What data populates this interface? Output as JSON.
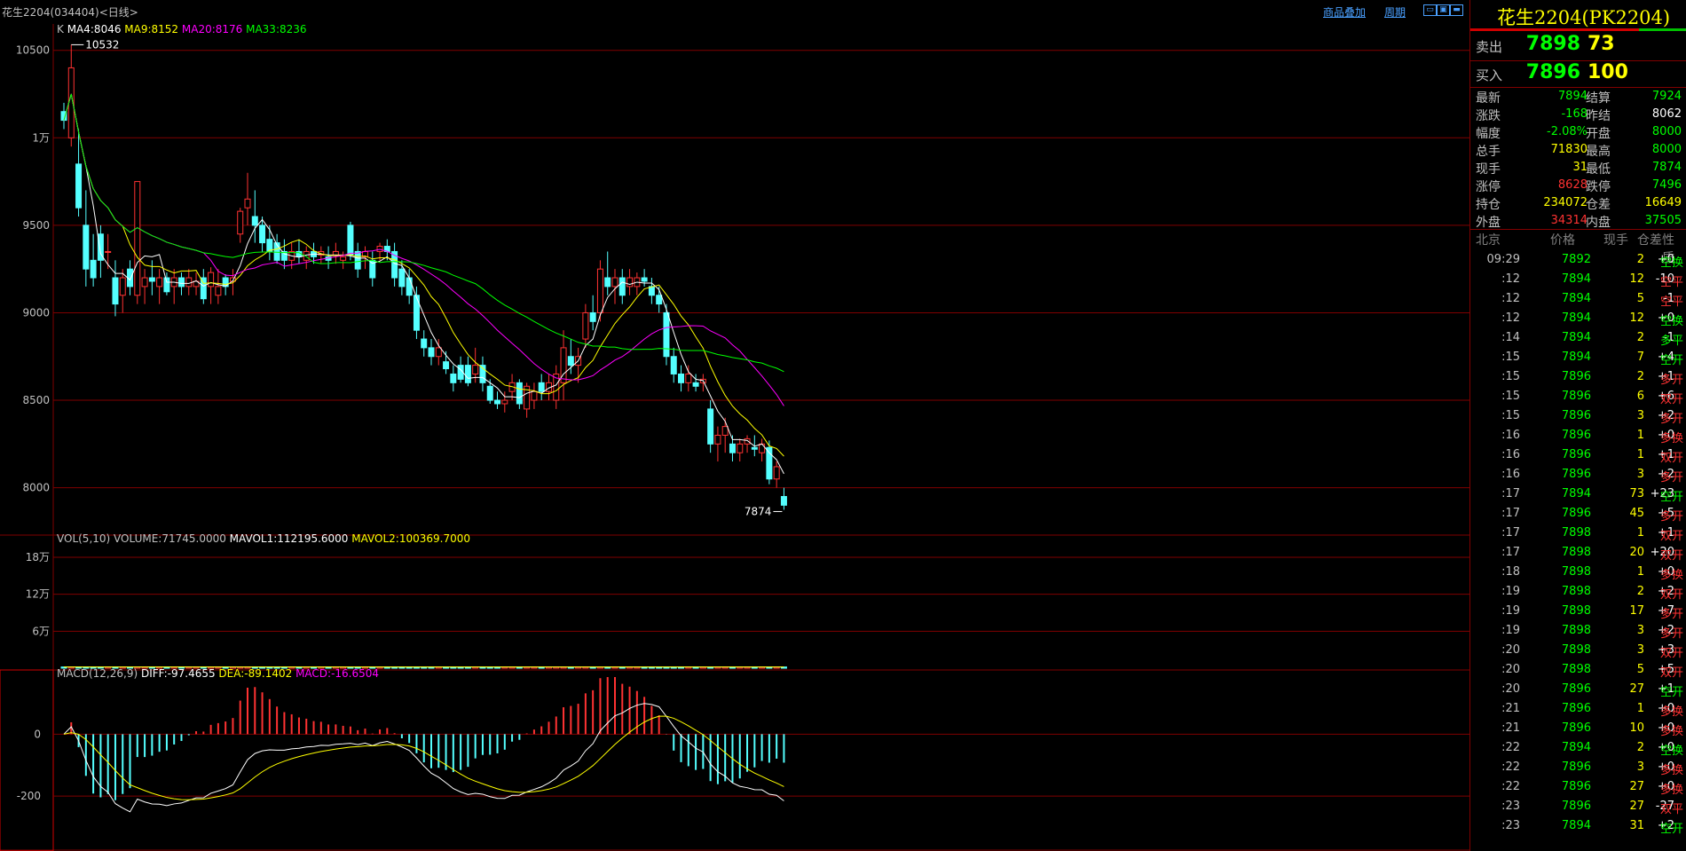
{
  "header": {
    "title": "花生2204(034404)<日线>",
    "link_overlay": "商品叠加",
    "link_period": "周期",
    "window_buttons": [
      "minimize-icon",
      "restore-icon",
      "close-icon"
    ]
  },
  "colors": {
    "up": "#ff3232",
    "down": "#54ffff",
    "ma4": "#ffffff",
    "ma9": "#ffff00",
    "ma20": "#ff00ff",
    "ma33": "#00ff00",
    "grid": "#800000",
    "axis_text": "#c0c0c0"
  },
  "chart_data": [
    {
      "type": "candlestick",
      "legend": {
        "prefix": "K",
        "items": [
          "MA4:8046",
          "MA9:8152",
          "MA20:8176",
          "MA33:8236"
        ]
      },
      "ylim": [
        7780,
        10600
      ],
      "y_ticks": [
        {
          "v": 10500,
          "label": "10500"
        },
        {
          "v": 10000,
          "label": "1万"
        },
        {
          "v": 9500,
          "label": "9500"
        },
        {
          "v": 9000,
          "label": "9000"
        },
        {
          "v": 8500,
          "label": "8500"
        },
        {
          "v": 8000,
          "label": "8000"
        }
      ],
      "annotations": [
        {
          "label": "10532",
          "value": 10532,
          "bar": 1
        },
        {
          "label": "7874",
          "value": 7874,
          "bar": 98
        }
      ],
      "ohlc": [
        [
          10150,
          10200,
          10050,
          10100
        ],
        [
          10000,
          10532,
          9950,
          10400
        ],
        [
          9850,
          10050,
          9550,
          9600
        ],
        [
          9500,
          9700,
          9150,
          9250
        ],
        [
          9300,
          9450,
          9150,
          9200
        ],
        [
          9450,
          9500,
          9200,
          9300
        ],
        [
          9350,
          9450,
          9250,
          9350
        ],
        [
          9200,
          9300,
          8980,
          9050
        ],
        [
          9100,
          9250,
          9000,
          9200
        ],
        [
          9250,
          9300,
          9100,
          9150
        ],
        [
          9100,
          9700,
          9050,
          9750
        ],
        [
          9150,
          9250,
          9050,
          9200
        ],
        [
          9200,
          9300,
          9100,
          9180
        ],
        [
          9150,
          9250,
          9050,
          9200
        ],
        [
          9200,
          9230,
          9100,
          9120
        ],
        [
          9150,
          9250,
          9050,
          9200
        ],
        [
          9200,
          9230,
          9100,
          9150
        ],
        [
          9150,
          9250,
          9100,
          9200
        ],
        [
          9150,
          9230,
          9100,
          9180
        ],
        [
          9200,
          9250,
          9050,
          9080
        ],
        [
          9150,
          9260,
          9050,
          9230
        ],
        [
          9100,
          9250,
          9050,
          9150
        ],
        [
          9200,
          9220,
          9100,
          9150
        ],
        [
          9180,
          9250,
          9100,
          9200
        ],
        [
          9450,
          9600,
          9400,
          9580
        ],
        [
          9600,
          9800,
          9500,
          9650
        ],
        [
          9550,
          9700,
          9400,
          9500
        ],
        [
          9500,
          9550,
          9350,
          9400
        ],
        [
          9420,
          9500,
          9300,
          9350
        ],
        [
          9400,
          9450,
          9280,
          9300
        ],
        [
          9350,
          9420,
          9250,
          9300
        ],
        [
          9300,
          9400,
          9250,
          9350
        ],
        [
          9350,
          9420,
          9280,
          9320
        ],
        [
          9300,
          9380,
          9250,
          9350
        ],
        [
          9350,
          9400,
          9280,
          9320
        ],
        [
          9330,
          9380,
          9280,
          9350
        ],
        [
          9320,
          9380,
          9250,
          9300
        ],
        [
          9330,
          9400,
          9280,
          9350
        ],
        [
          9300,
          9350,
          9250,
          9320
        ],
        [
          9500,
          9520,
          9300,
          9330
        ],
        [
          9350,
          9400,
          9200,
          9250
        ],
        [
          9320,
          9380,
          9250,
          9350
        ],
        [
          9300,
          9350,
          9150,
          9200
        ],
        [
          9350,
          9400,
          9300,
          9380
        ],
        [
          9380,
          9420,
          9300,
          9350
        ],
        [
          9350,
          9400,
          9150,
          9200
        ],
        [
          9250,
          9300,
          9100,
          9150
        ],
        [
          9200,
          9250,
          9050,
          9100
        ],
        [
          9100,
          9150,
          8850,
          8900
        ],
        [
          8850,
          8900,
          8750,
          8800
        ],
        [
          8800,
          8850,
          8700,
          8750
        ],
        [
          8750,
          8850,
          8700,
          8800
        ],
        [
          8720,
          8780,
          8650,
          8680
        ],
        [
          8650,
          8700,
          8550,
          8600
        ],
        [
          8700,
          8750,
          8600,
          8620
        ],
        [
          8700,
          8750,
          8580,
          8600
        ],
        [
          8650,
          8800,
          8600,
          8700
        ],
        [
          8700,
          8750,
          8550,
          8600
        ],
        [
          8580,
          8620,
          8480,
          8500
        ],
        [
          8500,
          8550,
          8450,
          8480
        ],
        [
          8480,
          8550,
          8430,
          8500
        ],
        [
          8550,
          8650,
          8500,
          8600
        ],
        [
          8600,
          8620,
          8450,
          8480
        ],
        [
          8450,
          8600,
          8400,
          8580
        ],
        [
          8500,
          8600,
          8450,
          8550
        ],
        [
          8600,
          8650,
          8500,
          8550
        ],
        [
          8550,
          8650,
          8500,
          8600
        ],
        [
          8500,
          8700,
          8450,
          8650
        ],
        [
          8600,
          8900,
          8500,
          8800
        ],
        [
          8750,
          8850,
          8650,
          8700
        ],
        [
          8700,
          8800,
          8600,
          8750
        ],
        [
          8850,
          9050,
          8800,
          9000
        ],
        [
          9000,
          9100,
          8900,
          8950
        ],
        [
          9000,
          9300,
          8950,
          9250
        ],
        [
          9200,
          9350,
          9100,
          9150
        ],
        [
          9150,
          9250,
          9050,
          9200
        ],
        [
          9200,
          9250,
          9050,
          9100
        ],
        [
          9150,
          9250,
          9100,
          9200
        ],
        [
          9150,
          9230,
          9100,
          9200
        ],
        [
          9200,
          9250,
          9150,
          9180
        ],
        [
          9150,
          9200,
          9050,
          9100
        ],
        [
          9100,
          9150,
          9000,
          9050
        ],
        [
          9000,
          9050,
          8700,
          8750
        ],
        [
          8750,
          8800,
          8600,
          8650
        ],
        [
          8650,
          8700,
          8550,
          8600
        ],
        [
          8600,
          8700,
          8550,
          8650
        ],
        [
          8600,
          8650,
          8550,
          8580
        ],
        [
          8600,
          8650,
          8550,
          8620
        ],
        [
          8450,
          8500,
          8200,
          8250
        ],
        [
          8250,
          8350,
          8150,
          8300
        ],
        [
          8300,
          8400,
          8200,
          8350
        ],
        [
          8250,
          8300,
          8150,
          8200
        ],
        [
          8200,
          8280,
          8150,
          8250
        ],
        [
          8250,
          8300,
          8200,
          8280
        ],
        [
          8230,
          8300,
          8180,
          8220
        ],
        [
          8200,
          8280,
          8150,
          8250
        ],
        [
          8230,
          8270,
          8020,
          8050
        ],
        [
          8050,
          8150,
          8000,
          8120
        ],
        [
          7950,
          8000,
          7874,
          7900
        ]
      ]
    },
    {
      "type": "bar",
      "legend": {
        "prefix": "VOL(5,10)",
        "items": [
          "VOLUME:71745.0000",
          "MAVOL1:112195.6000",
          "MAVOL2:100369.7000"
        ]
      },
      "ylim": [
        0,
        190000
      ],
      "y_ticks": [
        {
          "v": 180000,
          "label": "18万"
        },
        {
          "v": 120000,
          "label": "12万"
        },
        {
          "v": 60000,
          "label": "6万"
        }
      ],
      "values": [
        2000,
        2000,
        2000,
        2000,
        2000,
        2000,
        2000,
        2000,
        2000,
        2000,
        2000,
        2000,
        2000,
        2000,
        2000,
        2000,
        2000,
        2000,
        2000,
        2000,
        2000,
        2000,
        2000,
        2000,
        2000,
        2000,
        2000,
        2000,
        2000,
        2000,
        2000,
        2000,
        2000,
        2000,
        2000,
        2000,
        2000,
        2000,
        2000,
        2000,
        2000,
        2000,
        2000,
        2000,
        2000,
        2000,
        2000,
        2000,
        2000,
        2000,
        2000,
        2000,
        2000,
        2000,
        2000,
        2000,
        2000,
        2000,
        2000,
        2000,
        2000,
        2000,
        2000,
        2000,
        2000,
        2000,
        2000,
        2000,
        2000,
        2000,
        2000,
        2000,
        2000,
        2000,
        2000,
        2000,
        2000,
        2000,
        2000,
        2000,
        2000,
        2000,
        2000,
        2000,
        2000,
        2000,
        2000,
        2000,
        2000,
        2000,
        2000,
        2000,
        2000,
        2000,
        2000,
        2000,
        2000,
        2000,
        2000,
        2000,
        2000,
        2000,
        2000,
        2000,
        2000,
        2000,
        2000,
        2000,
        2000,
        2000,
        2000,
        2000,
        2000,
        2000,
        2000,
        2000,
        2000,
        2000,
        2000,
        2000,
        2000,
        2000,
        2000,
        2000,
        2000
      ]
    },
    {
      "type": "bar",
      "legend": {
        "prefix": "MACD(12,26,9)",
        "items": [
          "DIFF:-97.4655",
          "DEA:-89.1402",
          "MACD:-16.6504"
        ]
      },
      "ylim": [
        -360,
        190
      ],
      "y_ticks": [
        {
          "v": 0,
          "label": "0"
        },
        {
          "v": -200,
          "label": "-200"
        }
      ]
    }
  ],
  "side": {
    "title": "花生2204(PK2204)",
    "sell": {
      "label": "卖出",
      "price": "7898",
      "volume": "73"
    },
    "buy": {
      "label": "买入",
      "price": "7896",
      "volume": "100"
    },
    "quotes": [
      {
        "l1": "最新",
        "v1": "7894",
        "c1": "#00ff00",
        "l2": "结算",
        "v2": "7924",
        "c2": "#00ff00"
      },
      {
        "l1": "涨跌",
        "v1": "-168",
        "c1": "#00ff00",
        "l2": "昨结",
        "v2": "8062",
        "c2": "#ffffff"
      },
      {
        "l1": "幅度",
        "v1": "-2.08%",
        "c1": "#00ff00",
        "l2": "开盘",
        "v2": "8000",
        "c2": "#00ff00"
      },
      {
        "l1": "总手",
        "v1": "71830",
        "c1": "#ffff00",
        "l2": "最高",
        "v2": "8000",
        "c2": "#00ff00"
      },
      {
        "l1": "现手",
        "v1": "31",
        "c1": "#ffff00",
        "l2": "最低",
        "v2": "7874",
        "c2": "#00ff00"
      },
      {
        "l1": "涨停",
        "v1": "8628",
        "c1": "#ff3232",
        "l2": "跌停",
        "v2": "7496",
        "c2": "#00ff00"
      },
      {
        "l1": "持仓",
        "v1": "234072",
        "c1": "#ffff00",
        "l2": "仓差",
        "v2": "16649",
        "c2": "#ffff00"
      },
      {
        "l1": "外盘",
        "v1": "34314",
        "c1": "#ff3232",
        "l2": "内盘",
        "v2": "37505",
        "c2": "#00ff00"
      }
    ],
    "tick_headers": [
      "北京",
      "价格",
      "现手",
      "仓差",
      "性质"
    ],
    "ticks": [
      {
        "time": "09:29",
        "price": "7892",
        "hand": "2",
        "oi": "+0",
        "nature": "空换",
        "pc": "#00ff00",
        "nc": "#00ff00"
      },
      {
        "time": ":12",
        "price": "7894",
        "hand": "12",
        "oi": "-10",
        "nature": "空平",
        "pc": "#00ff00",
        "nc": "#ff3232"
      },
      {
        "time": ":12",
        "price": "7894",
        "hand": "5",
        "oi": "-1",
        "nature": "空平",
        "pc": "#00ff00",
        "nc": "#ff3232"
      },
      {
        "time": ":12",
        "price": "7894",
        "hand": "12",
        "oi": "+0",
        "nature": "空换",
        "pc": "#00ff00",
        "nc": "#00ff00"
      },
      {
        "time": ":14",
        "price": "7894",
        "hand": "2",
        "oi": "-1",
        "nature": "多平",
        "pc": "#00ff00",
        "nc": "#00ff00"
      },
      {
        "time": ":15",
        "price": "7894",
        "hand": "7",
        "oi": "+4",
        "nature": "空开",
        "pc": "#00ff00",
        "nc": "#00ff00"
      },
      {
        "time": ":15",
        "price": "7896",
        "hand": "2",
        "oi": "+1",
        "nature": "多开",
        "pc": "#00ff00",
        "nc": "#ff3232"
      },
      {
        "time": ":15",
        "price": "7896",
        "hand": "6",
        "oi": "+6",
        "nature": "双开",
        "pc": "#00ff00",
        "nc": "#ff3232"
      },
      {
        "time": ":15",
        "price": "7896",
        "hand": "3",
        "oi": "+2",
        "nature": "多开",
        "pc": "#00ff00",
        "nc": "#ff3232"
      },
      {
        "time": ":16",
        "price": "7896",
        "hand": "1",
        "oi": "+0",
        "nature": "多换",
        "pc": "#00ff00",
        "nc": "#ff3232"
      },
      {
        "time": ":16",
        "price": "7896",
        "hand": "1",
        "oi": "+1",
        "nature": "双开",
        "pc": "#00ff00",
        "nc": "#ff3232"
      },
      {
        "time": ":16",
        "price": "7896",
        "hand": "3",
        "oi": "+2",
        "nature": "多开",
        "pc": "#00ff00",
        "nc": "#ff3232"
      },
      {
        "time": ":17",
        "price": "7894",
        "hand": "73",
        "oi": "+23",
        "nature": "空开",
        "pc": "#00ff00",
        "nc": "#00ff00"
      },
      {
        "time": ":17",
        "price": "7896",
        "hand": "45",
        "oi": "+5",
        "nature": "多开",
        "pc": "#00ff00",
        "nc": "#ff3232"
      },
      {
        "time": ":17",
        "price": "7898",
        "hand": "1",
        "oi": "+1",
        "nature": "双开",
        "pc": "#00ff00",
        "nc": "#ff3232"
      },
      {
        "time": ":17",
        "price": "7898",
        "hand": "20",
        "oi": "+20",
        "nature": "双开",
        "pc": "#00ff00",
        "nc": "#ff3232"
      },
      {
        "time": ":18",
        "price": "7898",
        "hand": "1",
        "oi": "+0",
        "nature": "多换",
        "pc": "#00ff00",
        "nc": "#ff3232"
      },
      {
        "time": ":19",
        "price": "7898",
        "hand": "2",
        "oi": "+2",
        "nature": "双开",
        "pc": "#00ff00",
        "nc": "#ff3232"
      },
      {
        "time": ":19",
        "price": "7898",
        "hand": "17",
        "oi": "+7",
        "nature": "多开",
        "pc": "#00ff00",
        "nc": "#ff3232"
      },
      {
        "time": ":19",
        "price": "7898",
        "hand": "3",
        "oi": "+2",
        "nature": "多开",
        "pc": "#00ff00",
        "nc": "#ff3232"
      },
      {
        "time": ":20",
        "price": "7898",
        "hand": "3",
        "oi": "+3",
        "nature": "双开",
        "pc": "#00ff00",
        "nc": "#ff3232"
      },
      {
        "time": ":20",
        "price": "7898",
        "hand": "5",
        "oi": "+5",
        "nature": "双开",
        "pc": "#00ff00",
        "nc": "#ff3232"
      },
      {
        "time": ":20",
        "price": "7896",
        "hand": "27",
        "oi": "+1",
        "nature": "空开",
        "pc": "#00ff00",
        "nc": "#00ff00"
      },
      {
        "time": ":21",
        "price": "7896",
        "hand": "1",
        "oi": "+0",
        "nature": "多换",
        "pc": "#00ff00",
        "nc": "#ff3232"
      },
      {
        "time": ":21",
        "price": "7896",
        "hand": "10",
        "oi": "+0",
        "nature": "多换",
        "pc": "#00ff00",
        "nc": "#ff3232"
      },
      {
        "time": ":22",
        "price": "7894",
        "hand": "2",
        "oi": "+0",
        "nature": "空换",
        "pc": "#00ff00",
        "nc": "#00ff00"
      },
      {
        "time": ":22",
        "price": "7896",
        "hand": "3",
        "oi": "+0",
        "nature": "多换",
        "pc": "#00ff00",
        "nc": "#ff3232"
      },
      {
        "time": ":22",
        "price": "7896",
        "hand": "27",
        "oi": "+0",
        "nature": "多换",
        "pc": "#00ff00",
        "nc": "#ff3232"
      },
      {
        "time": ":23",
        "price": "7896",
        "hand": "27",
        "oi": "-27",
        "nature": "双平",
        "pc": "#00ff00",
        "nc": "#ff3232"
      },
      {
        "time": ":23",
        "price": "7894",
        "hand": "31",
        "oi": "+2",
        "nature": "空开",
        "pc": "#00ff00",
        "nc": "#00ff00"
      }
    ]
  }
}
